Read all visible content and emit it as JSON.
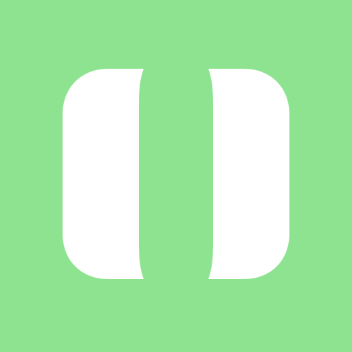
{
  "icon": {
    "name": "split-panel-icon",
    "background_color": "#8ee390",
    "shape_color": "#ffffff"
  }
}
